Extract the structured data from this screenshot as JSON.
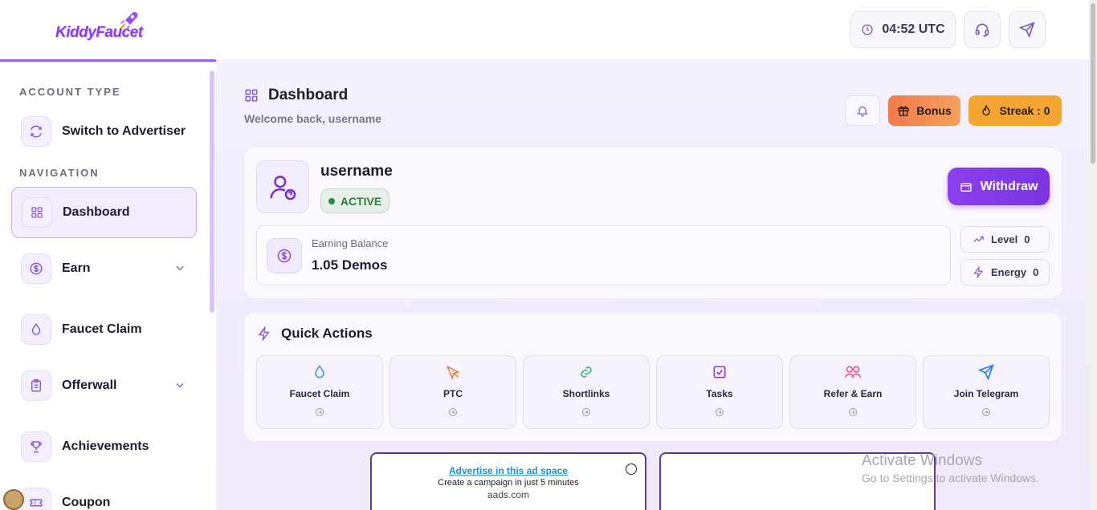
{
  "brand": {
    "name": "KiddyFaucet"
  },
  "header": {
    "time": "04:52",
    "timezone": "UTC"
  },
  "sidebar": {
    "account_section": "ACCOUNT TYPE",
    "switch_label": "Switch to Advertiser",
    "nav_section": "NAVIGATION",
    "items": [
      {
        "label": "Dashboard",
        "icon": "grid-icon",
        "active": true
      },
      {
        "label": "Earn",
        "icon": "coin-icon",
        "dropdown": true
      },
      {
        "label": "Faucet Claim",
        "icon": "drop-icon"
      },
      {
        "label": "Offerwall",
        "icon": "clipboard-icon",
        "dropdown": true
      },
      {
        "label": "Achievements",
        "icon": "trophy-icon"
      },
      {
        "label": "Coupon",
        "icon": "ticket-icon"
      }
    ]
  },
  "page": {
    "title": "Dashboard",
    "welcome": "Welcome back, username",
    "bonus_label": "Bonus",
    "streak_label": "Streak : ",
    "streak_value": "0"
  },
  "profile": {
    "username": "username",
    "status": "ACTIVE",
    "withdraw_label": "Withdraw",
    "balance_label": "Earning Balance",
    "balance_value": "1.05 Demos",
    "level_label": "Level",
    "level_value": "0",
    "energy_label": "Energy",
    "energy_value": "0"
  },
  "quick_actions": {
    "title": "Quick Actions",
    "items": [
      {
        "label": "Faucet Claim",
        "icon": "drop-icon",
        "color": "#3aa0e8"
      },
      {
        "label": "PTC",
        "icon": "cursor-icon",
        "color": "#f08040"
      },
      {
        "label": "Shortlinks",
        "icon": "link-icon",
        "color": "#3cb870"
      },
      {
        "label": "Tasks",
        "icon": "checkbox-icon",
        "color": "#8b3fe8"
      },
      {
        "label": "Refer & Earn",
        "icon": "users-icon",
        "color": "#e85a8a"
      },
      {
        "label": "Join Telegram",
        "icon": "telegram-icon",
        "color": "#2a7de0"
      }
    ]
  },
  "ad": {
    "link": "Advertise in this ad space",
    "subtitle": "Create a campaign in just 5 minutes",
    "domain": "aads.com"
  },
  "watermark": {
    "line1": "Activate Windows",
    "line2": "Go to Settings to activate Windows."
  },
  "colors": {
    "accent": "#8b3fe8",
    "bonus": "#f27a4a",
    "streak": "#f5a531",
    "active_green": "#2d7b3e"
  }
}
